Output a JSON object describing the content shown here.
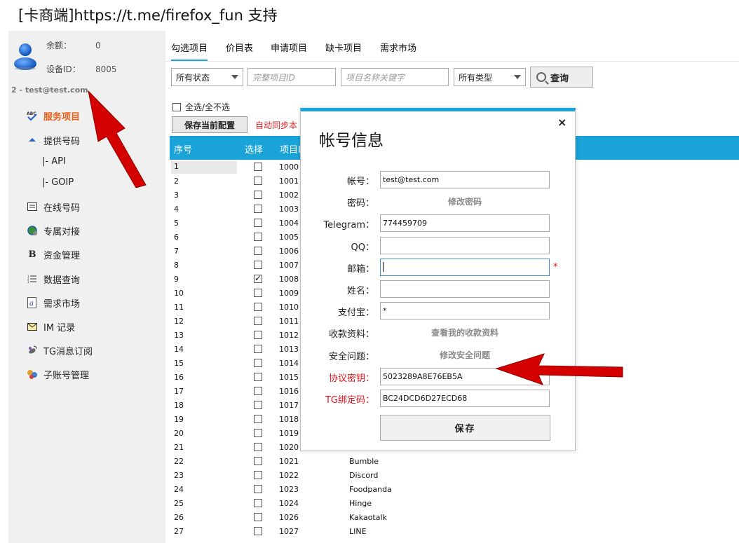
{
  "header": {
    "title_bracket_open": "[",
    "title_brand": "卡商端",
    "title_bracket_close": "]",
    "title_url": "https://t.me/firefox_fun",
    "title_suffix": "支持"
  },
  "sidebar": {
    "balance_label": "余额：",
    "balance_value": "0",
    "device_label": "设备ID：",
    "device_value": "8005",
    "user_line": "2 - test@test.com",
    "menu": [
      {
        "label": "服务项目",
        "icon": "abc-check-icon",
        "active": true
      },
      {
        "label": "提供号码",
        "icon": "upload-icon"
      },
      {
        "label": "|-  API",
        "sub": true
      },
      {
        "label": "|-  GOIP",
        "sub": true
      },
      {
        "label": "在线号码",
        "icon": "list-icon"
      },
      {
        "label": "专属对接",
        "icon": "globe-icon"
      },
      {
        "label": "资金管理",
        "icon": "bold-b-icon"
      },
      {
        "label": "数据查询",
        "icon": "numbered-list-icon"
      },
      {
        "label": "需求市场",
        "icon": "a-icon"
      },
      {
        "label": "IM 记录",
        "icon": "envelope-icon"
      },
      {
        "label": "TG消息订阅",
        "icon": "satellite-icon"
      },
      {
        "label": "子账号管理",
        "icon": "users-icon"
      }
    ]
  },
  "tabs": [
    {
      "label": "勾选项目",
      "active": true
    },
    {
      "label": "价目表"
    },
    {
      "label": "申请项目"
    },
    {
      "label": "缺卡项目"
    },
    {
      "label": "需求市场"
    }
  ],
  "filters": {
    "status_select": "所有状态",
    "project_id_placeholder": "完整项目ID",
    "project_name_placeholder": "项目名称关键字",
    "type_select": "所有类型",
    "query_label": "查询"
  },
  "toolbar": {
    "select_all_label": "全选/全不选",
    "save_config_label": "保存当前配置",
    "auto_sync_text": "自动同步本"
  },
  "table": {
    "columns": [
      "序号",
      "选择",
      "项目I"
    ],
    "rows": [
      {
        "no": "1",
        "id": "1000",
        "name": "",
        "checked": false
      },
      {
        "no": "2",
        "id": "1001",
        "name": "",
        "checked": false
      },
      {
        "no": "3",
        "id": "1002",
        "name": "",
        "checked": false
      },
      {
        "no": "4",
        "id": "1003",
        "name": "",
        "checked": false
      },
      {
        "no": "5",
        "id": "1004",
        "name": "",
        "checked": false
      },
      {
        "no": "6",
        "id": "1005",
        "name": "",
        "checked": false
      },
      {
        "no": "7",
        "id": "1006",
        "name": "",
        "checked": false
      },
      {
        "no": "8",
        "id": "1007",
        "name": "",
        "checked": false
      },
      {
        "no": "9",
        "id": "1008",
        "name": "",
        "checked": true
      },
      {
        "no": "10",
        "id": "1009",
        "name": "",
        "checked": false
      },
      {
        "no": "11",
        "id": "1010",
        "name": "",
        "checked": false
      },
      {
        "no": "12",
        "id": "1011",
        "name": "",
        "checked": false
      },
      {
        "no": "13",
        "id": "1012",
        "name": "",
        "checked": false
      },
      {
        "no": "14",
        "id": "1013",
        "name": "",
        "checked": false
      },
      {
        "no": "15",
        "id": "1014",
        "name": "",
        "checked": false
      },
      {
        "no": "16",
        "id": "1015",
        "name": "",
        "checked": false
      },
      {
        "no": "17",
        "id": "1016",
        "name": "",
        "checked": false
      },
      {
        "no": "18",
        "id": "1017",
        "name": "",
        "checked": false
      },
      {
        "no": "19",
        "id": "1018",
        "name": "",
        "checked": false
      },
      {
        "no": "20",
        "id": "1019",
        "name": "",
        "checked": false
      },
      {
        "no": "21",
        "id": "1020",
        "name": "",
        "checked": false
      },
      {
        "no": "22",
        "id": "1021",
        "name": "Bumble",
        "checked": false
      },
      {
        "no": "23",
        "id": "1022",
        "name": "Discord",
        "checked": false
      },
      {
        "no": "24",
        "id": "1023",
        "name": "Foodpanda",
        "checked": false
      },
      {
        "no": "25",
        "id": "1024",
        "name": "Hinge",
        "checked": false
      },
      {
        "no": "26",
        "id": "1026",
        "name": "Kakaotalk",
        "checked": false
      },
      {
        "no": "27",
        "id": "1027",
        "name": "LINE",
        "checked": false
      }
    ]
  },
  "modal": {
    "title": "帐号信息",
    "close": "×",
    "fields": [
      {
        "label": "帐号：",
        "type": "input",
        "value": "test@test.com"
      },
      {
        "label": "密码：",
        "type": "link",
        "value": "修改密码"
      },
      {
        "label": "Telegram：",
        "type": "input",
        "value": "774459709"
      },
      {
        "label": "QQ：",
        "type": "input",
        "value": ""
      },
      {
        "label": "邮箱：",
        "type": "input",
        "value": "",
        "focus": true,
        "required": "*"
      },
      {
        "label": "姓名：",
        "type": "input",
        "value": ""
      },
      {
        "label": "支付宝：",
        "type": "input",
        "value": "*"
      },
      {
        "label": "收款资料：",
        "type": "link",
        "value": "查看我的收款资料"
      },
      {
        "label": "安全问题：",
        "type": "link",
        "value": "修改安全问题"
      },
      {
        "label": "协议密钥：",
        "type": "input",
        "value": "5023289A8E76EB5A",
        "red": true
      },
      {
        "label": "TG绑定码：",
        "type": "input",
        "value": "BC24DCD6D27ECD68",
        "red": true
      }
    ],
    "save_label": "保存"
  },
  "colors": {
    "accent": "#1aa3d9",
    "active_menu": "#e8611a",
    "warning_red": "#e0141e",
    "arrow_red": "#d40000"
  }
}
